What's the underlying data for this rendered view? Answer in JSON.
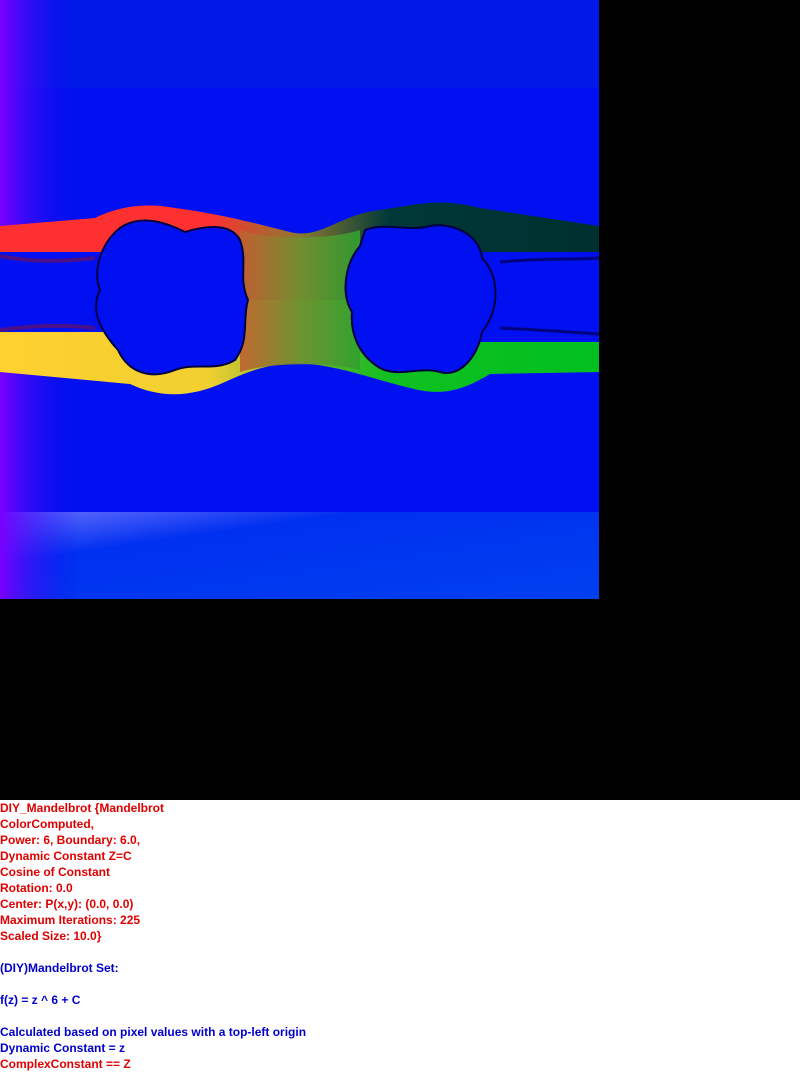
{
  "colors": {
    "field_blue": "#0010f0",
    "red_band": "#ff3030",
    "yellow_band": "#ffd030",
    "green_band": "#00c020",
    "dark_teal_band": "#003030",
    "background": "#000000",
    "text_red": "#e00000",
    "text_blue": "#0000cc"
  },
  "info": {
    "lines": [
      {
        "text": "DIY_Mandelbrot {Mandelbrot",
        "color": "red"
      },
      {
        "text": "ColorComputed,",
        "color": "red"
      },
      {
        "text": "Power: 6, Boundary: 6.0,",
        "color": "red"
      },
      {
        "text": "Dynamic Constant Z=C",
        "color": "red"
      },
      {
        "text": "Cosine of Constant",
        "color": "red"
      },
      {
        "text": "Rotation: 0.0",
        "color": "red"
      },
      {
        "text": "Center: P(x,y): (0.0, 0.0)",
        "color": "red"
      },
      {
        "text": "Maximum Iterations: 225",
        "color": "red"
      },
      {
        "text": "Scaled Size: 10.0}",
        "color": "red"
      },
      {
        "text": "",
        "color": "blue"
      },
      {
        "text": "(DIY)Mandelbrot Set:",
        "color": "blue"
      },
      {
        "text": "",
        "color": "blue"
      },
      {
        "text": "f(z) = z ^ 6 + C",
        "color": "blue"
      },
      {
        "text": "",
        "color": "blue"
      },
      {
        "text": "Calculated based on pixel values with a top-left origin",
        "color": "blue"
      },
      {
        "text": "Dynamic Constant = z",
        "color": "blue"
      },
      {
        "text": "ComplexConstant == Z",
        "color": "red"
      }
    ]
  }
}
